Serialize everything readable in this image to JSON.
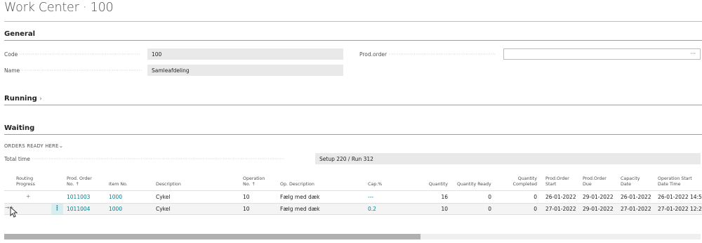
{
  "page": {
    "title": "Work Center · 100"
  },
  "general": {
    "heading": "General",
    "code_label": "Code",
    "code_value": "100",
    "name_label": "Name",
    "name_value": "Samleafdeling",
    "prodorder_label": "Prod.order",
    "prodorder_value": "",
    "lookup": "···"
  },
  "running": {
    "heading": "Running",
    "chevron": "›"
  },
  "waiting": {
    "heading": "Waiting",
    "orders_label": "ORDERS READY HERE",
    "orders_chevron": "⌄",
    "total_time_label": "Total time",
    "total_time_value": "Setup 220  /  Run 312"
  },
  "table": {
    "headers": [
      [
        "Routing",
        "Progress"
      ],
      [
        "Prod. Order",
        "No. ↑"
      ],
      [
        "Item No.",
        ""
      ],
      [
        "Description",
        ""
      ],
      [
        "Operation",
        "No. ↑"
      ],
      [
        "Op. Description",
        ""
      ],
      [
        "Cap.%",
        ""
      ],
      [
        "Quantity",
        ""
      ],
      [
        "Quantity Ready",
        ""
      ],
      [
        "Quantity",
        "Completed"
      ],
      [
        "Prod.Order",
        "Start"
      ],
      [
        "Prod.Order",
        "Due"
      ],
      [
        "Capacity",
        "Date"
      ],
      [
        "Operation Start",
        "Date Time"
      ]
    ],
    "rows": [
      {
        "progress": "+",
        "prod_order_no": "1011003",
        "item_no": "1000",
        "description": "Cykel",
        "operation_no": "10",
        "op_description": "Fælg med dæk",
        "cap_pct": "---",
        "quantity": "16",
        "quantity_ready": "0",
        "quantity_completed": "0",
        "start": "26-01-2022",
        "due": "29-01-2022",
        "capacity_date": "26-01-2022",
        "op_start": "26-01-2022 14:5"
      },
      {
        "progress": "→+",
        "prod_order_no": "1011004",
        "item_no": "1000",
        "description": "Cykel",
        "operation_no": "10",
        "op_description": "Fælg med dæk",
        "cap_pct": "0.2",
        "quantity": "10",
        "quantity_ready": "0",
        "quantity_completed": "0",
        "start": "27-01-2022",
        "due": "29-01-2022",
        "capacity_date": "27-01-2022",
        "op_start": "27-01-2022 12:2"
      }
    ]
  },
  "colors": {
    "link": "#00838f",
    "field_bg": "#e9e9e9",
    "selection": "#d6eef0"
  }
}
